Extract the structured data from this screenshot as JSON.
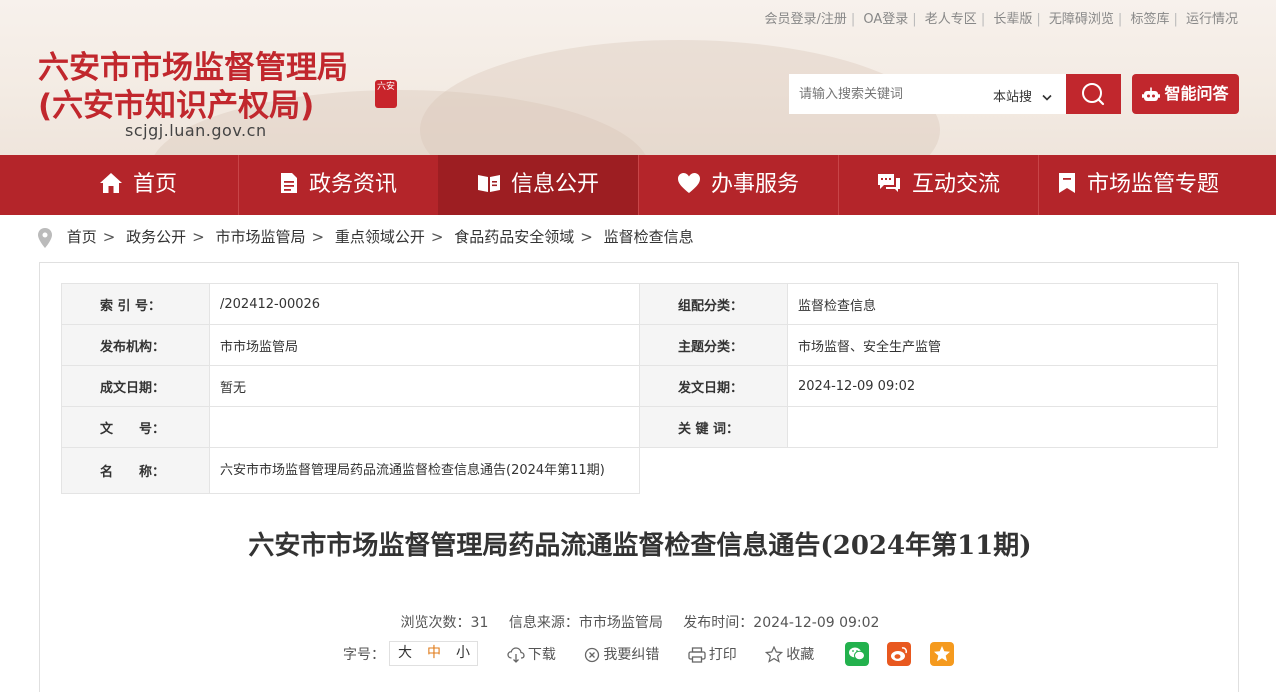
{
  "header": {
    "site_title_line1": "六安市市场监督管理局",
    "site_title_line2": "(六安市知识产权局)",
    "site_url": "scjgj.luan.gov.cn",
    "seal_text": "六安",
    "top_links": [
      "会员登录/注册",
      "OA登录",
      "老人专区",
      "长辈版",
      "无障碍浏览",
      "标签库",
      "运行情况"
    ],
    "search": {
      "placeholder": "请输入搜索关键词",
      "scope_label": "本站搜"
    },
    "ai_button_label": "智能问答",
    "colors": {
      "brand_red": "#c1272d",
      "nav_red": "#b4252a",
      "nav_active": "#9d1e22"
    }
  },
  "nav": {
    "items": [
      {
        "label": "首页",
        "icon": "home-icon"
      },
      {
        "label": "政务资讯",
        "icon": "document-icon"
      },
      {
        "label": "信息公开",
        "icon": "open-book-icon",
        "active": true
      },
      {
        "label": "办事服务",
        "icon": "heart-icon"
      },
      {
        "label": "互动交流",
        "icon": "chat-icon"
      },
      {
        "label": "市场监管专题",
        "icon": "bookmark-icon"
      }
    ]
  },
  "breadcrumb": [
    "首页",
    "政务公开",
    "市市场监管局",
    "重点领域公开",
    "食品药品安全领域",
    "监督检查信息"
  ],
  "meta": {
    "index_label": "索 引 号：",
    "index_value": "/202412-00026",
    "group_label": "组配分类：",
    "group_value": "监督检查信息",
    "publisher_label": "发布机构：",
    "publisher_value": "市市场监管局",
    "topic_label": "主题分类：",
    "topic_value": "市场监督、安全生产监管",
    "written_date_label": "成文日期：",
    "written_date_value": "暂无",
    "issue_date_label": "发文日期：",
    "issue_date_value": "2024-12-09 09:02",
    "doc_no_label": "文　　号：",
    "doc_no_value": "",
    "keywords_label": "关 键 词：",
    "keywords_value": "",
    "name_label": "名　　称：",
    "name_value": "六安市市场监督管理局药品流通监督检查信息通告(2024年第11期)"
  },
  "article": {
    "title": "六安市市场监督管理局药品流通监督检查信息通告(2024年第11期)",
    "views": "浏览次数：31",
    "source": "信息来源：市市场监管局",
    "publish_time": "发布时间：2024-12-09 09:02"
  },
  "tools": {
    "font_size_label": "字号：",
    "font_sizes": [
      "大",
      "中",
      "小"
    ],
    "download": "下载",
    "correction": "我要纠错",
    "print": "打印",
    "favorite": "收藏"
  }
}
